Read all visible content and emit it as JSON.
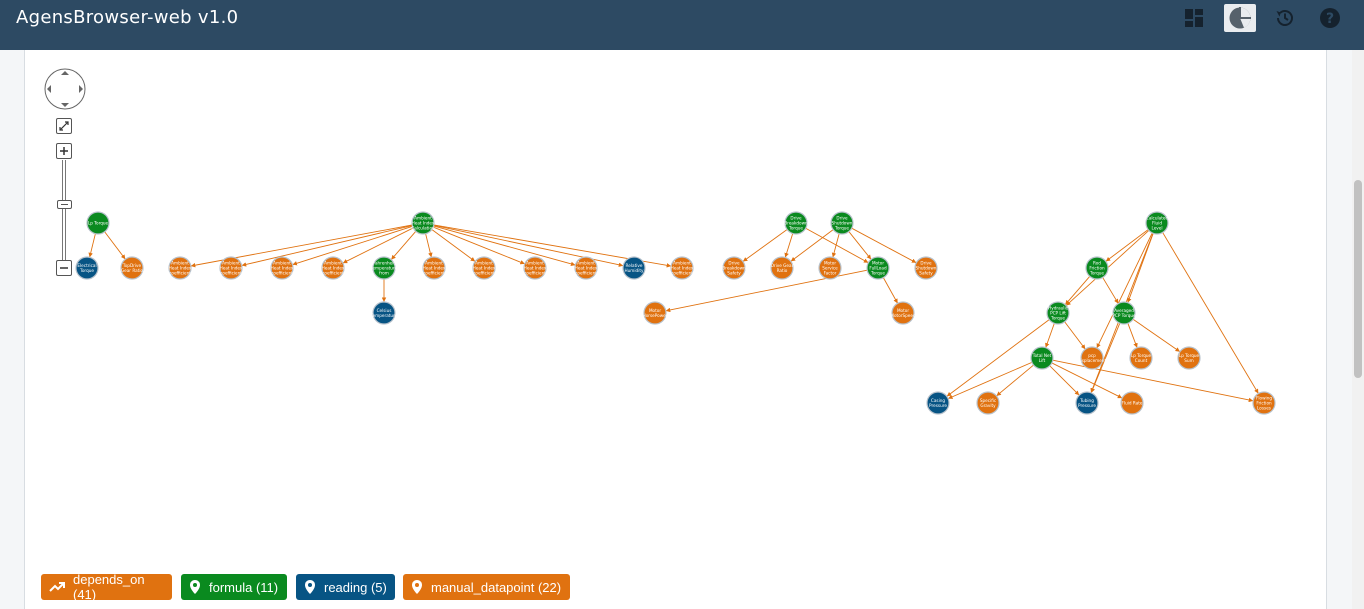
{
  "app": {
    "title": "AgensBrowser-web v1.0"
  },
  "toolbar": {
    "icons": [
      "dashboard-icon",
      "pie-chart-icon",
      "history-icon",
      "help-icon"
    ]
  },
  "colors": {
    "formula": "#0a8a1f",
    "reading": "#075484",
    "manual": "#e07210",
    "edge": "#e07210",
    "header": "#2d4a63"
  },
  "graph": {
    "nodes": [
      {
        "label": "Lp Torque",
        "type": "formula"
      },
      {
        "label": "Electrical Torque",
        "type": "reading"
      },
      {
        "label": "TopDrive Gear Ratio",
        "type": "manual"
      },
      {
        "label": "Ambient Heat Index coefficient",
        "type": "manual"
      },
      {
        "label": "Ambient Heat Index coefficient",
        "type": "manual"
      },
      {
        "label": "Ambient Heat Index coefficient",
        "type": "manual"
      },
      {
        "label": "Ambient Heat Index coefficient",
        "type": "manual"
      },
      {
        "label": "Fahrenheit temperature from Celsius",
        "type": "formula"
      },
      {
        "label": "Ambient Heat Index coefficient",
        "type": "manual"
      },
      {
        "label": "Ambient Heat Index coefficient",
        "type": "manual"
      },
      {
        "label": "Ambient Heat Index coefficient",
        "type": "manual"
      },
      {
        "label": "Ambient Heat Index coefficient",
        "type": "manual"
      },
      {
        "label": "Relative Humidity",
        "type": "reading"
      },
      {
        "label": "Ambient Heat Index coefficient",
        "type": "manual"
      },
      {
        "label": "Celsius Temperature",
        "type": "reading"
      },
      {
        "label": "Ambient Heat Index Calculation",
        "type": "formula"
      },
      {
        "label": "Drive Breakdown Torque",
        "type": "formula"
      },
      {
        "label": "Drive Shutdown Torque",
        "type": "formula"
      },
      {
        "label": "Drive Breakdown Safety Factor",
        "type": "manual"
      },
      {
        "label": "Drive Gear Ratio",
        "type": "manual"
      },
      {
        "label": "Motor Service Factor",
        "type": "manual"
      },
      {
        "label": "Motor FullLoad Torque",
        "type": "formula"
      },
      {
        "label": "Drive Shutdown Safety Factor",
        "type": "manual"
      },
      {
        "label": "Motor HorsePower",
        "type": "manual"
      },
      {
        "label": "Motor MotorSpeed",
        "type": "manual"
      },
      {
        "label": "Calculated Fluid Level",
        "type": "formula"
      },
      {
        "label": "Rod Friction Torque",
        "type": "formula"
      },
      {
        "label": "Hydraulic PCP Lift Torque",
        "type": "formula"
      },
      {
        "label": "Averaged PCP Torque",
        "type": "formula"
      },
      {
        "label": "pcp displacement",
        "type": "manual"
      },
      {
        "label": "Lp Torque Count",
        "type": "manual"
      },
      {
        "label": "Lp Torque Sum",
        "type": "manual"
      },
      {
        "label": "Total Net Lift",
        "type": "formula"
      },
      {
        "label": "Casing Pressure",
        "type": "reading"
      },
      {
        "label": "Specific Gravity",
        "type": "manual"
      },
      {
        "label": "Tubing Pressure",
        "type": "reading"
      },
      {
        "label": "Fluid Rate",
        "type": "manual"
      },
      {
        "label": "Flowing Friction Losses",
        "type": "manual"
      }
    ]
  },
  "legend": {
    "depends_on": "depends_on (41)",
    "formula": "formula (11)",
    "reading": "reading (5)",
    "manual": "manual_datapoint (22)"
  }
}
